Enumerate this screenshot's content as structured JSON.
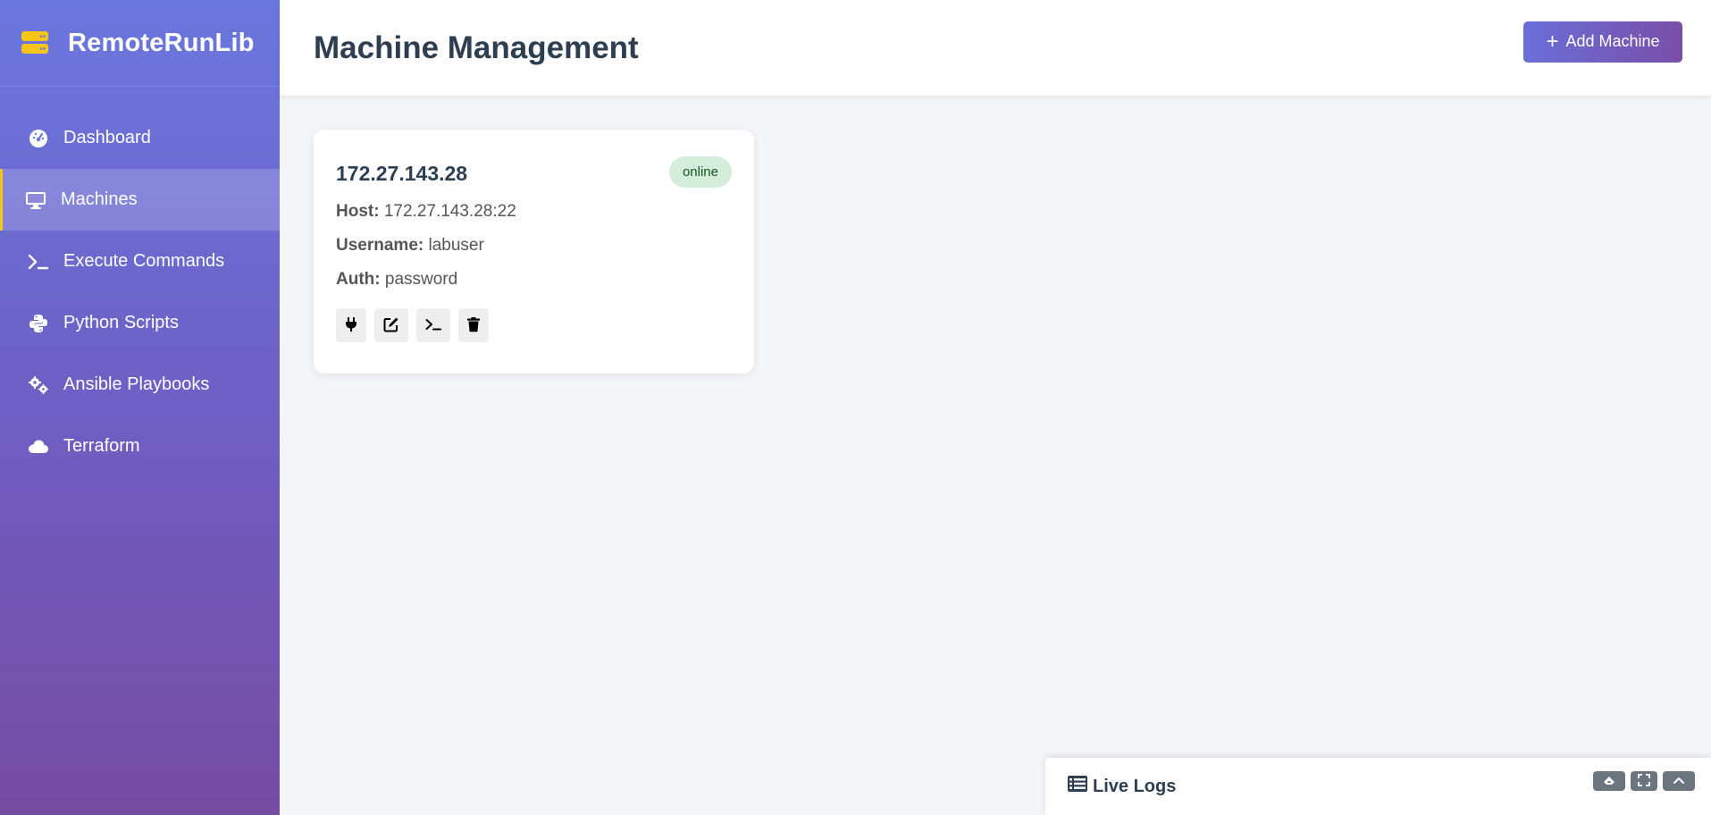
{
  "app": {
    "name": "RemoteRunLib"
  },
  "sidebar": {
    "items": [
      {
        "label": "Dashboard",
        "icon": "dashboard-icon",
        "active": false
      },
      {
        "label": "Machines",
        "icon": "desktop-icon",
        "active": true
      },
      {
        "label": "Execute Commands",
        "icon": "terminal-icon",
        "active": false
      },
      {
        "label": "Python Scripts",
        "icon": "python-icon",
        "active": false
      },
      {
        "label": "Ansible Playbooks",
        "icon": "cogs-icon",
        "active": false
      },
      {
        "label": "Terraform",
        "icon": "cloud-icon",
        "active": false
      }
    ]
  },
  "header": {
    "title": "Machine Management",
    "add_button_label": "Add Machine"
  },
  "machine": {
    "name": "172.27.143.28",
    "status": "online",
    "host_label": "Host:",
    "host_value": "172.27.143.28:22",
    "username_label": "Username:",
    "username_value": "labuser",
    "auth_label": "Auth:",
    "auth_value": "password",
    "actions": [
      "plug-icon",
      "edit-icon",
      "terminal-icon",
      "trash-icon"
    ]
  },
  "logs": {
    "title": "Live Logs",
    "controls": [
      "eraser-icon",
      "expand-icon",
      "chevron-up-icon"
    ]
  },
  "colors": {
    "accent": "#667eea",
    "accent_dark": "#764ba2",
    "active_marker": "#f5c518",
    "online_bg": "#d4edda",
    "online_text": "#155724"
  }
}
